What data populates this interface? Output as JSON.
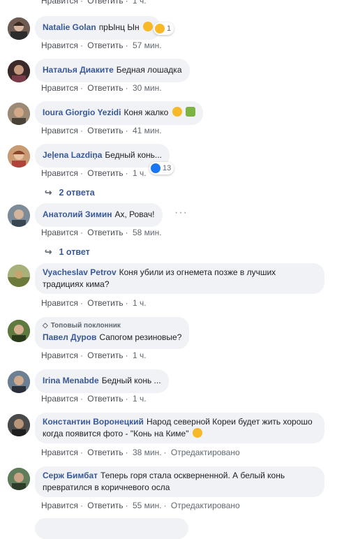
{
  "actions": {
    "like": "Нравится",
    "reply": "Ответить",
    "sep": "·",
    "edited": "Отредактировано"
  },
  "top_partial": {
    "like": "Нравится",
    "reply": "Ответить",
    "time": "1 ч."
  },
  "comments": [
    {
      "author": "Natalie Golan",
      "text": "прЫнц Ын",
      "time": "57 мин.",
      "reaction_count": "1",
      "reaction": "haha"
    },
    {
      "author": "Наталья Диаките",
      "text": "Бедная лошадка",
      "time": "30 мин."
    },
    {
      "author": "Ioura Giorgio Yezidi",
      "text": "Коня жалко",
      "time": "41 мин."
    },
    {
      "author": "Jeļena Lazdiņa",
      "text": "Бедный конь...",
      "time": "1 ч.",
      "reaction_count": "13",
      "reaction": "like"
    },
    {
      "author": "Анатолий Зимин",
      "text": "Ах, Ровач!",
      "time": "58 мин."
    },
    {
      "author": "Vyacheslav Petrov",
      "text": "Коня убили из огнемета позже в лучших традициях кима?",
      "time": "1 ч."
    },
    {
      "author": "Павел Дуров",
      "text": "Сапогом резиновые?",
      "time": "1 ч.",
      "badge": "Топовый поклонник"
    },
    {
      "author": "Irina Menabde",
      "text": "Бедный конь ...",
      "time": "1 ч."
    },
    {
      "author": "Константин Воронецкий",
      "text": "Народ северной Кореи будет жить хорошо когда появится фото - \"Конь на Киме\"",
      "time": "38 мин.",
      "edited": true
    },
    {
      "author": "Серж Бимбат",
      "text": "Теперь горя стала оскверненной. А белый конь превратился в коричневого осла",
      "time": "55 мин.",
      "edited": true
    }
  ],
  "replies": [
    {
      "label": "2 ответа"
    },
    {
      "label": "1 ответ"
    }
  ],
  "colors": {
    "author": "#385898",
    "bubble": "#f0f2f5",
    "meta": "#606770",
    "like_blue": "#1877f2",
    "haha_yellow": "#f7b928"
  }
}
